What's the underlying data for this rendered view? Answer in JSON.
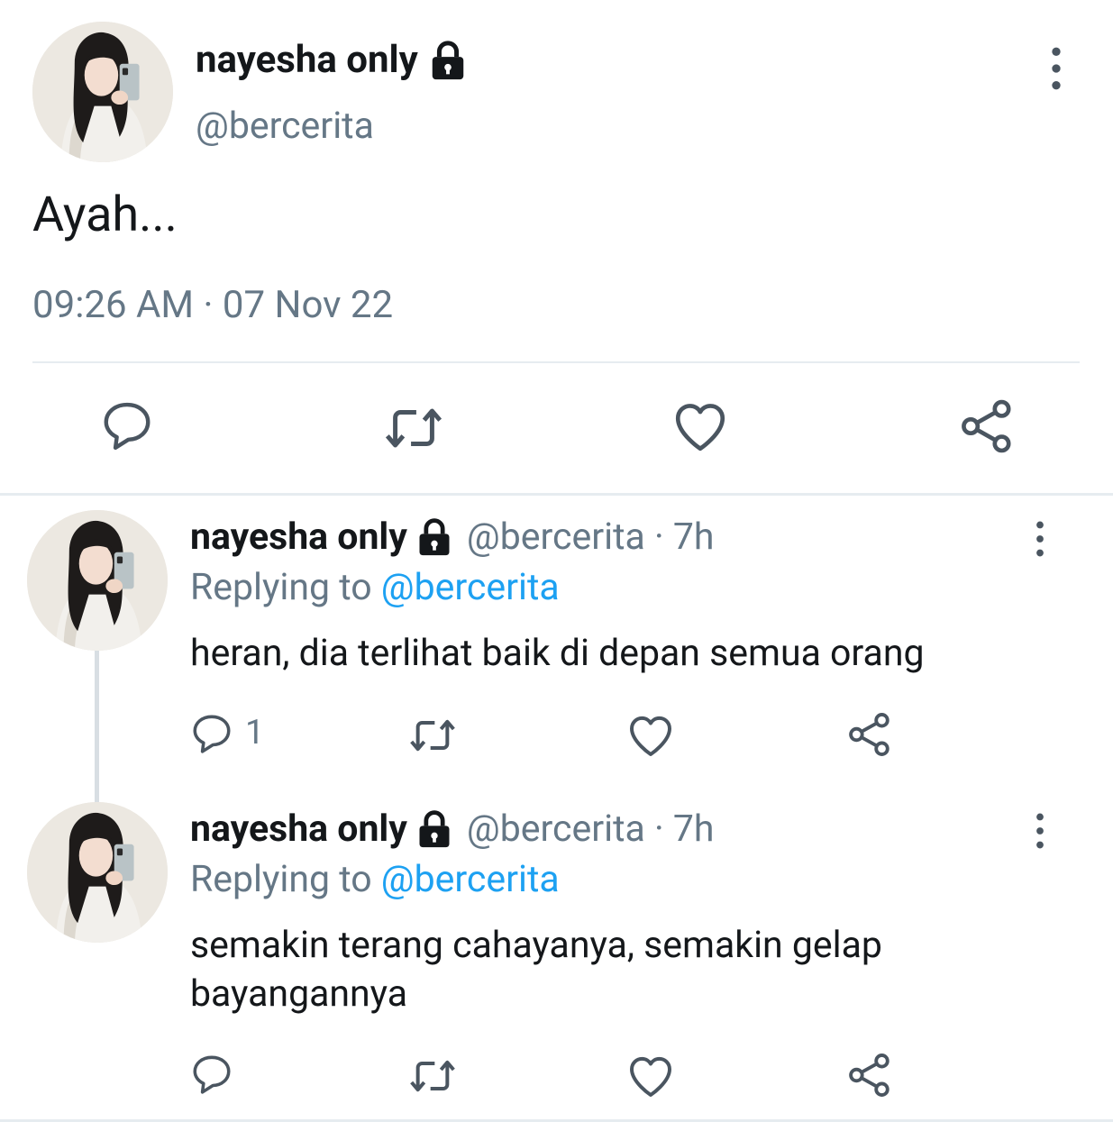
{
  "main_tweet": {
    "name": "nayesha only",
    "handle": "@bercerita",
    "text": "Ayah...",
    "timestamp": "09:26 AM · 07 Nov 22"
  },
  "replies": [
    {
      "name": "nayesha only",
      "handle_time": "@bercerita · 7h",
      "replying_prefix": "Replying to",
      "replying_mention": "@bercerita",
      "text": "heran, dia terlihat baik di depan semua orang",
      "reply_count": "1"
    },
    {
      "name": "nayesha only",
      "handle_time": "@bercerita · 7h",
      "replying_prefix": "Replying to",
      "replying_mention": "@bercerita",
      "text": "semakin terang cahayanya, semakin gelap bayangannya",
      "reply_count": ""
    }
  ],
  "icons": {
    "reply": "speech-bubble-icon",
    "retweet": "retweet-icon",
    "like": "heart-icon",
    "share": "share-icon",
    "more": "vertical-dots-icon",
    "protected": "lock-icon"
  },
  "colors": {
    "text": "#14171a",
    "secondary": "#657786",
    "link": "#1da1f2",
    "divider": "#e6ecf0"
  }
}
